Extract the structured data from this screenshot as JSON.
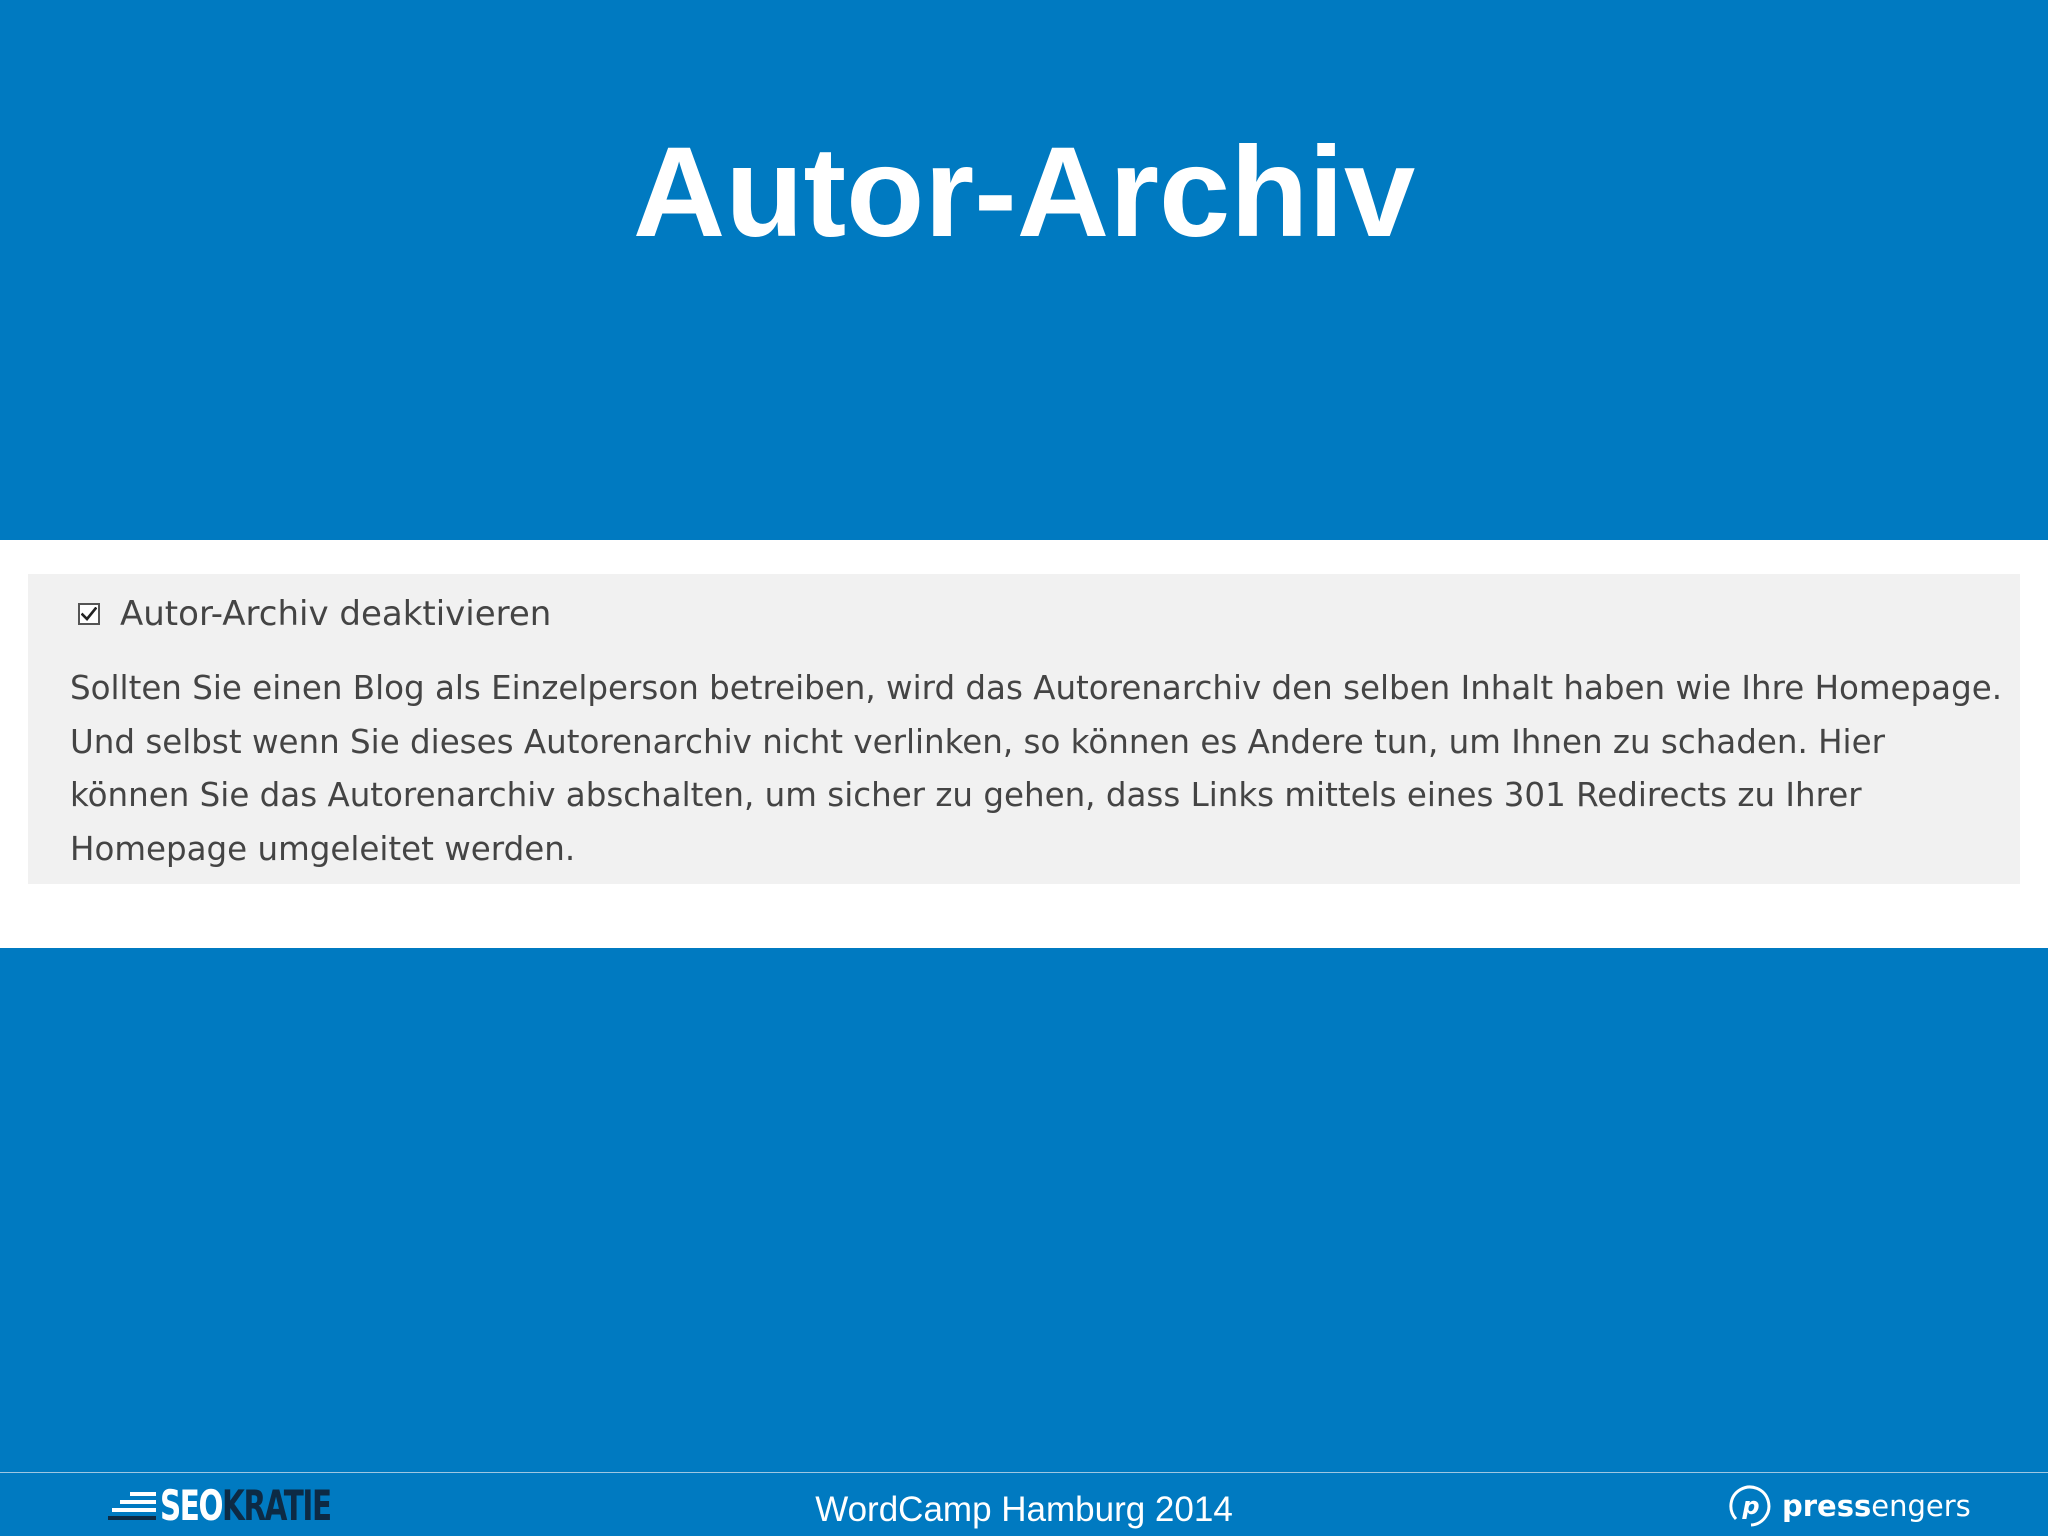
{
  "slide": {
    "title": "Autor-Archiv"
  },
  "settings": {
    "checkbox_label": "Autor-Archiv deaktivieren",
    "checkbox_checked": true,
    "description": "Sollten Sie einen Blog als Einzelperson betreiben, wird das Autorenarchiv den selben Inhalt haben wie Ihre Homepage. Und selbst wenn Sie dieses Autorenarchiv nicht verlinken, so können es Andere tun, um Ihnen zu schaden. Hier können Sie das Autorenarchiv abschalten, um sicher zu gehen, dass Links mittels eines 301 Redirects zu Ihrer Homepage umgeleitet werden."
  },
  "footer": {
    "event": "WordCamp Hamburg 2014",
    "logo_left": {
      "part1": "SEO",
      "part2": "KRATIE"
    },
    "logo_right": {
      "part1": "press",
      "part2": "engers",
      "icon": "p-circle-icon"
    }
  },
  "colors": {
    "background": "#007ac1",
    "panel": "#f1f1f1",
    "band": "#ffffff",
    "text": "#444444",
    "logo_dark": "#0d2a44"
  }
}
